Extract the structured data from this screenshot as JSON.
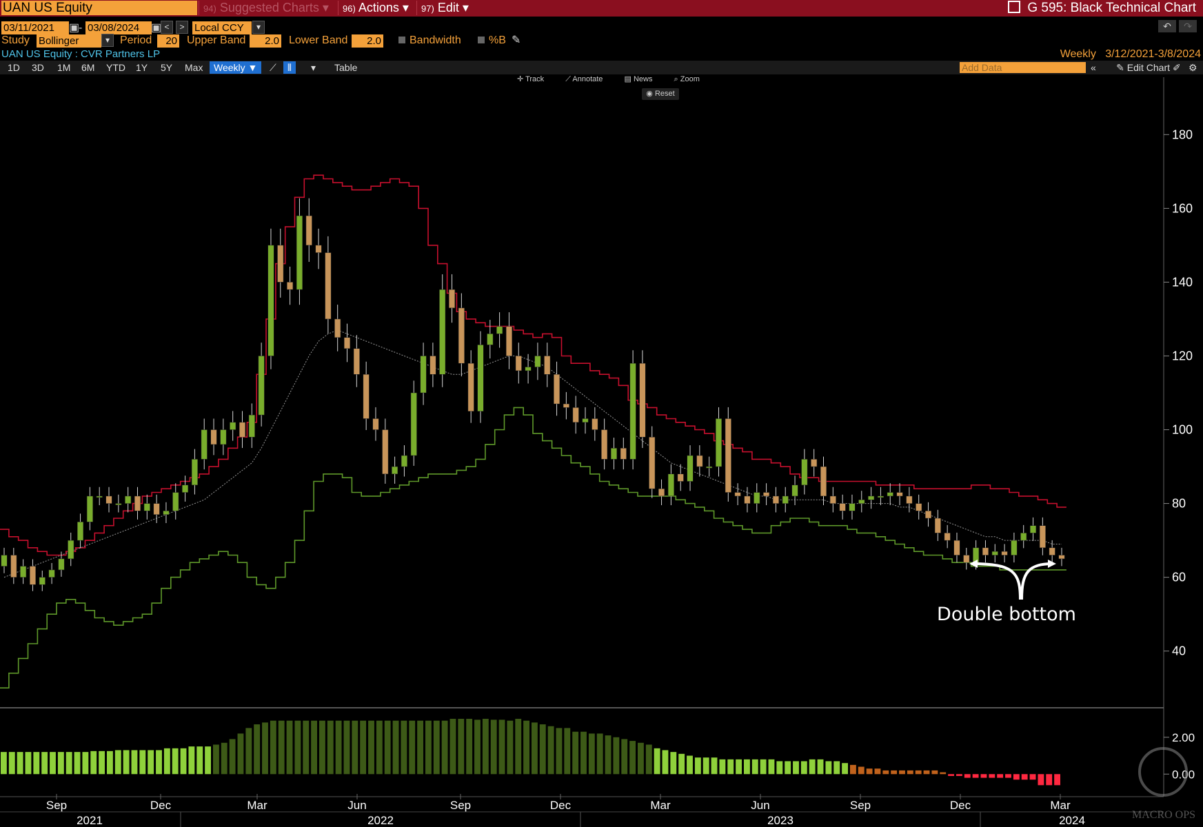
{
  "header": {
    "ticker": "UAN US Equity",
    "menu_suggested_num": "94)",
    "menu_suggested": "Suggested Charts",
    "menu_actions_num": "96)",
    "menu_actions": "Actions",
    "menu_edit_num": "97)",
    "menu_edit": "Edit",
    "window_title": "G 595: Black Technical Chart"
  },
  "controls": {
    "start_date": "03/11/2021",
    "end_date": "03/08/2024",
    "currency": "Local CCY",
    "study_label": "Study",
    "study": "Bollinger",
    "period_label": "Period",
    "period": "20",
    "upper_label": "Upper Band",
    "upper": "2.0",
    "lower_label": "Lower Band",
    "lower": "2.0",
    "bandwidth_label": "Bandwidth",
    "pctb_label": "%B"
  },
  "security_name": "UAN US Equity : CVR Partners LP",
  "range_info": {
    "freq": "Weekly",
    "range": "3/12/2021-3/8/2024"
  },
  "toolbar": {
    "periods": [
      "1D",
      "3D",
      "1M",
      "6M",
      "YTD",
      "1Y",
      "5Y",
      "Max"
    ],
    "freq": "Weekly ▼",
    "table": "Table",
    "add_data_placeholder": "Add Data",
    "edit_chart": "Edit Chart",
    "track": "Track",
    "annotate": "Annotate",
    "news": "News",
    "zoom": "Zoom",
    "reset": "Reset"
  },
  "annotation": "Double bottom",
  "watermark": "MACRO OPS",
  "colors": {
    "up": "#79ad2c",
    "down": "#c8955a",
    "upper_band": "#c8102e",
    "lower_band": "#5f9a2a",
    "mid_band": "#9a9a9a",
    "pctb_bright": "#8fd13b",
    "pctb_dark": "#3d5a17",
    "pctb_orange": "#c0621c",
    "pctb_red": "#ff2840"
  },
  "chart_data": {
    "type": "candlestick",
    "frequency": "weekly",
    "ylim": [
      25,
      195
    ],
    "y_ticks": [
      40,
      60,
      80,
      100,
      120,
      140,
      160,
      180
    ],
    "x_tick_labels": [
      "Sep",
      "Dec",
      "Mar",
      "Jun",
      "Sep",
      "Dec",
      "Mar",
      "Jun",
      "Sep",
      "Dec",
      "Mar"
    ],
    "year_labels": [
      "2021",
      "2022",
      "2023",
      "2024"
    ],
    "close": [
      66,
      60,
      63,
      58,
      60,
      62,
      65,
      70,
      75,
      82,
      82,
      80,
      80,
      82,
      78,
      80,
      77,
      78,
      83,
      85,
      92,
      100,
      96,
      100,
      102,
      98,
      104,
      120,
      150,
      140,
      138,
      158,
      150,
      148,
      130,
      125,
      122,
      115,
      103,
      100,
      88,
      90,
      93,
      110,
      120,
      115,
      138,
      133,
      118,
      105,
      123,
      126,
      128,
      120,
      116,
      117,
      120,
      115,
      107,
      106,
      102,
      103,
      100,
      92,
      95,
      92,
      118,
      98,
      84,
      82,
      88,
      86,
      93,
      90,
      90,
      103,
      83,
      82,
      80,
      83,
      82,
      80,
      82,
      85,
      92,
      90,
      82,
      80,
      78,
      80,
      81,
      82,
      82,
      83,
      82,
      80,
      78,
      76,
      72,
      70,
      66,
      64,
      68,
      66,
      67,
      66,
      70,
      72,
      74,
      68,
      66,
      65
    ],
    "upper_band": [
      73,
      71,
      70,
      68,
      67,
      66,
      66,
      67,
      68,
      70,
      72,
      74,
      76,
      78,
      80,
      82,
      83,
      84,
      85,
      86,
      87,
      88,
      90,
      92,
      95,
      98,
      102,
      115,
      130,
      145,
      155,
      163,
      168,
      169,
      168,
      167,
      166,
      165,
      165,
      166,
      167,
      168,
      167,
      166,
      160,
      150,
      145,
      137,
      132,
      130,
      129,
      128,
      128,
      128,
      127,
      126,
      125,
      126,
      125,
      120,
      118,
      118,
      116,
      115,
      114,
      112,
      108,
      107,
      106,
      104,
      103,
      102,
      101,
      100,
      99,
      97,
      96,
      95,
      94,
      92,
      92,
      91,
      90,
      88,
      87,
      87,
      86,
      86,
      86,
      86,
      86,
      86,
      85,
      85,
      85,
      85,
      84,
      84,
      84,
      84,
      84,
      84,
      85,
      85,
      84,
      84,
      83,
      82,
      82,
      81,
      80,
      79
    ],
    "mid_band": [
      60,
      61,
      62,
      63,
      64,
      65,
      66,
      67,
      68,
      69,
      70,
      71,
      72,
      73,
      74,
      75,
      76,
      77,
      78,
      79,
      80,
      81,
      83,
      85,
      87,
      89,
      91,
      95,
      100,
      105,
      110,
      115,
      120,
      124,
      126,
      127,
      126,
      125,
      124,
      123,
      122,
      121,
      120,
      119,
      118,
      117,
      116,
      115,
      115,
      116,
      117,
      118,
      119,
      120,
      120,
      119,
      118,
      117,
      115,
      113,
      111,
      109,
      107,
      105,
      103,
      101,
      99,
      97,
      95,
      93,
      91,
      90,
      89,
      88,
      87,
      86,
      85,
      84,
      83,
      82,
      82,
      81,
      81,
      81,
      81,
      81,
      81,
      80,
      80,
      80,
      80,
      80,
      80,
      80,
      79,
      79,
      78,
      77,
      76,
      75,
      74,
      73,
      72,
      71,
      71,
      70,
      70,
      70,
      70,
      70,
      69,
      69
    ],
    "lower_band": [
      30,
      34,
      38,
      42,
      46,
      50,
      53,
      54,
      53,
      51,
      49,
      48,
      47,
      48,
      49,
      50,
      53,
      57,
      60,
      62,
      64,
      65,
      66,
      67,
      66,
      64,
      60,
      58,
      57,
      60,
      64,
      70,
      78,
      86,
      88,
      88,
      87,
      83,
      82,
      82,
      83,
      84,
      85,
      86,
      87,
      88,
      88,
      88,
      89,
      90,
      92,
      96,
      100,
      104,
      106,
      104,
      99,
      97,
      95,
      93,
      91,
      90,
      88,
      86,
      85,
      84,
      83,
      82,
      82,
      82,
      82,
      81,
      80,
      79,
      78,
      76,
      75,
      74,
      73,
      72,
      72,
      74,
      75,
      76,
      76,
      75,
      74,
      74,
      74,
      73,
      72,
      72,
      71,
      70,
      69,
      68,
      67,
      66,
      66,
      65,
      64,
      64,
      63,
      63,
      63,
      62,
      62,
      62,
      62,
      62,
      62,
      62
    ],
    "pct_b": [
      1.2,
      1.2,
      1.2,
      1.2,
      1.2,
      1.2,
      1.2,
      1.2,
      1.2,
      1.2,
      1.2,
      1.25,
      1.25,
      1.25,
      1.3,
      1.3,
      1.3,
      1.3,
      1.3,
      1.3,
      1.4,
      1.4,
      1.4,
      1.5,
      1.5,
      1.5,
      1.6,
      1.7,
      1.9,
      2.2,
      2.5,
      2.7,
      2.8,
      2.9,
      2.9,
      2.9,
      2.9,
      2.9,
      2.9,
      2.9,
      2.9,
      2.9,
      2.9,
      2.9,
      2.9,
      2.9,
      2.9,
      2.9,
      2.9,
      2.9,
      2.9,
      2.9,
      2.9,
      2.9,
      2.9,
      3.0,
      3.0,
      3.0,
      2.95,
      3.0,
      2.95,
      2.95,
      2.9,
      3.0,
      2.9,
      2.8,
      2.7,
      2.6,
      2.5,
      2.5,
      2.3,
      2.3,
      2.2,
      2.2,
      2.1,
      2.0,
      1.9,
      1.8,
      1.7,
      1.6,
      1.4,
      1.3,
      1.2,
      1.1,
      1.0,
      0.9,
      0.9,
      0.9,
      0.8,
      0.8,
      0.8,
      0.8,
      0.8,
      0.8,
      0.8,
      0.7,
      0.7,
      0.7,
      0.7,
      0.8,
      0.8,
      0.7,
      0.7,
      0.6,
      0.5,
      0.4,
      0.3,
      0.3,
      0.2,
      0.2,
      0.2,
      0.2,
      0.2,
      0.2,
      0.2,
      0.1,
      -0.1,
      -0.1,
      -0.2,
      -0.2,
      -0.2,
      -0.2,
      -0.2,
      -0.2,
      -0.3,
      -0.3,
      -0.3,
      -0.6,
      -0.6,
      -0.6
    ],
    "pct_b_ticks": [
      0.0,
      2.0
    ]
  }
}
